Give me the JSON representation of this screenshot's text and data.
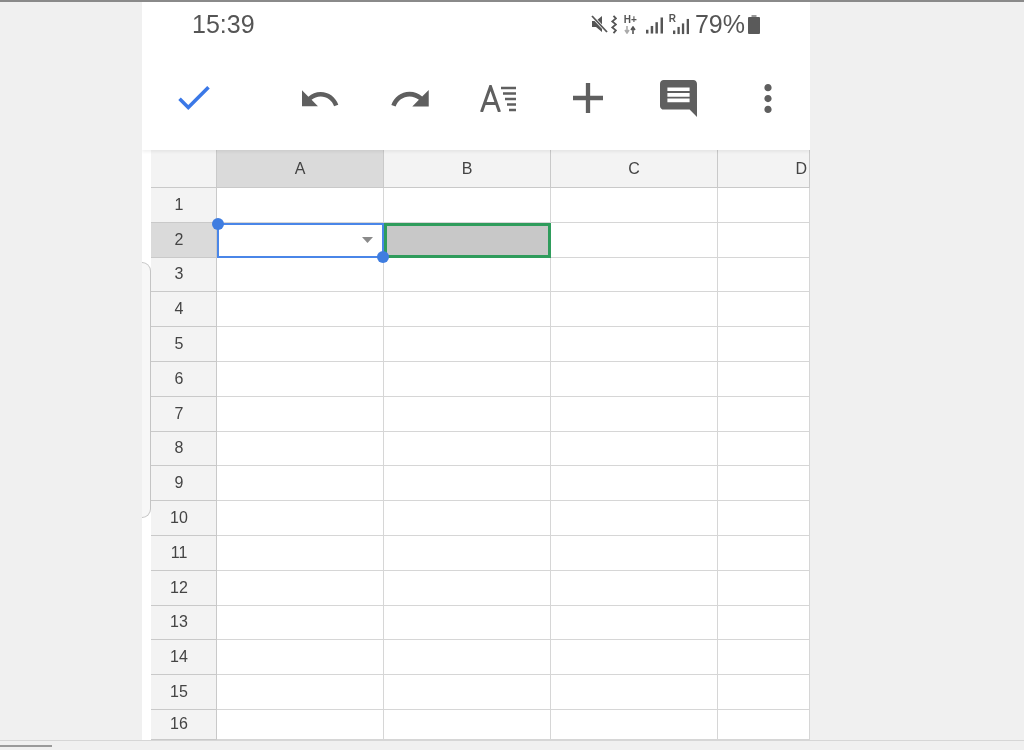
{
  "status_bar": {
    "time": "15:39",
    "network_type": "H+",
    "roaming_mark": "R",
    "battery": "79%"
  },
  "sheet": {
    "columns": [
      {
        "label": "A",
        "selected": true
      },
      {
        "label": "B",
        "selected": false
      },
      {
        "label": "C",
        "selected": false
      },
      {
        "label": "D",
        "selected": false
      }
    ],
    "rows": [
      {
        "label": "1",
        "selected": false,
        "cells": [
          {
            "selected": false,
            "highlighted": false,
            "dropdown": false
          },
          {
            "selected": false,
            "highlighted": false,
            "dropdown": false
          },
          {
            "selected": false,
            "highlighted": false,
            "dropdown": false
          },
          {
            "selected": false,
            "highlighted": false,
            "dropdown": false
          }
        ]
      },
      {
        "label": "2",
        "selected": true,
        "cells": [
          {
            "selected": true,
            "highlighted": false,
            "dropdown": true
          },
          {
            "selected": false,
            "highlighted": true,
            "dropdown": false
          },
          {
            "selected": false,
            "highlighted": false,
            "dropdown": false
          },
          {
            "selected": false,
            "highlighted": false,
            "dropdown": false
          }
        ]
      },
      {
        "label": "3",
        "selected": false,
        "cells": [
          {
            "selected": false,
            "highlighted": false,
            "dropdown": false
          },
          {
            "selected": false,
            "highlighted": false,
            "dropdown": false
          },
          {
            "selected": false,
            "highlighted": false,
            "dropdown": false
          },
          {
            "selected": false,
            "highlighted": false,
            "dropdown": false
          }
        ]
      },
      {
        "label": "4",
        "selected": false,
        "cells": [
          {
            "selected": false,
            "highlighted": false,
            "dropdown": false
          },
          {
            "selected": false,
            "highlighted": false,
            "dropdown": false
          },
          {
            "selected": false,
            "highlighted": false,
            "dropdown": false
          },
          {
            "selected": false,
            "highlighted": false,
            "dropdown": false
          }
        ]
      },
      {
        "label": "5",
        "selected": false,
        "cells": [
          {
            "selected": false,
            "highlighted": false,
            "dropdown": false
          },
          {
            "selected": false,
            "highlighted": false,
            "dropdown": false
          },
          {
            "selected": false,
            "highlighted": false,
            "dropdown": false
          },
          {
            "selected": false,
            "highlighted": false,
            "dropdown": false
          }
        ]
      },
      {
        "label": "6",
        "selected": false,
        "cells": [
          {
            "selected": false,
            "highlighted": false,
            "dropdown": false
          },
          {
            "selected": false,
            "highlighted": false,
            "dropdown": false
          },
          {
            "selected": false,
            "highlighted": false,
            "dropdown": false
          },
          {
            "selected": false,
            "highlighted": false,
            "dropdown": false
          }
        ]
      },
      {
        "label": "7",
        "selected": false,
        "cells": [
          {
            "selected": false,
            "highlighted": false,
            "dropdown": false
          },
          {
            "selected": false,
            "highlighted": false,
            "dropdown": false
          },
          {
            "selected": false,
            "highlighted": false,
            "dropdown": false
          },
          {
            "selected": false,
            "highlighted": false,
            "dropdown": false
          }
        ]
      },
      {
        "label": "8",
        "selected": false,
        "cells": [
          {
            "selected": false,
            "highlighted": false,
            "dropdown": false
          },
          {
            "selected": false,
            "highlighted": false,
            "dropdown": false
          },
          {
            "selected": false,
            "highlighted": false,
            "dropdown": false
          },
          {
            "selected": false,
            "highlighted": false,
            "dropdown": false
          }
        ]
      },
      {
        "label": "9",
        "selected": false,
        "cells": [
          {
            "selected": false,
            "highlighted": false,
            "dropdown": false
          },
          {
            "selected": false,
            "highlighted": false,
            "dropdown": false
          },
          {
            "selected": false,
            "highlighted": false,
            "dropdown": false
          },
          {
            "selected": false,
            "highlighted": false,
            "dropdown": false
          }
        ]
      },
      {
        "label": "10",
        "selected": false,
        "cells": [
          {
            "selected": false,
            "highlighted": false,
            "dropdown": false
          },
          {
            "selected": false,
            "highlighted": false,
            "dropdown": false
          },
          {
            "selected": false,
            "highlighted": false,
            "dropdown": false
          },
          {
            "selected": false,
            "highlighted": false,
            "dropdown": false
          }
        ]
      },
      {
        "label": "11",
        "selected": false,
        "cells": [
          {
            "selected": false,
            "highlighted": false,
            "dropdown": false
          },
          {
            "selected": false,
            "highlighted": false,
            "dropdown": false
          },
          {
            "selected": false,
            "highlighted": false,
            "dropdown": false
          },
          {
            "selected": false,
            "highlighted": false,
            "dropdown": false
          }
        ]
      },
      {
        "label": "12",
        "selected": false,
        "cells": [
          {
            "selected": false,
            "highlighted": false,
            "dropdown": false
          },
          {
            "selected": false,
            "highlighted": false,
            "dropdown": false
          },
          {
            "selected": false,
            "highlighted": false,
            "dropdown": false
          },
          {
            "selected": false,
            "highlighted": false,
            "dropdown": false
          }
        ]
      },
      {
        "label": "13",
        "selected": false,
        "cells": [
          {
            "selected": false,
            "highlighted": false,
            "dropdown": false
          },
          {
            "selected": false,
            "highlighted": false,
            "dropdown": false
          },
          {
            "selected": false,
            "highlighted": false,
            "dropdown": false
          },
          {
            "selected": false,
            "highlighted": false,
            "dropdown": false
          }
        ]
      },
      {
        "label": "14",
        "selected": false,
        "cells": [
          {
            "selected": false,
            "highlighted": false,
            "dropdown": false
          },
          {
            "selected": false,
            "highlighted": false,
            "dropdown": false
          },
          {
            "selected": false,
            "highlighted": false,
            "dropdown": false
          },
          {
            "selected": false,
            "highlighted": false,
            "dropdown": false
          }
        ]
      },
      {
        "label": "15",
        "selected": false,
        "cells": [
          {
            "selected": false,
            "highlighted": false,
            "dropdown": false
          },
          {
            "selected": false,
            "highlighted": false,
            "dropdown": false
          },
          {
            "selected": false,
            "highlighted": false,
            "dropdown": false
          },
          {
            "selected": false,
            "highlighted": false,
            "dropdown": false
          }
        ]
      },
      {
        "label": "16",
        "selected": false,
        "cells": [
          {
            "selected": false,
            "highlighted": false,
            "dropdown": false
          },
          {
            "selected": false,
            "highlighted": false,
            "dropdown": false
          },
          {
            "selected": false,
            "highlighted": false,
            "dropdown": false
          },
          {
            "selected": false,
            "highlighted": false,
            "dropdown": false
          }
        ]
      }
    ]
  }
}
